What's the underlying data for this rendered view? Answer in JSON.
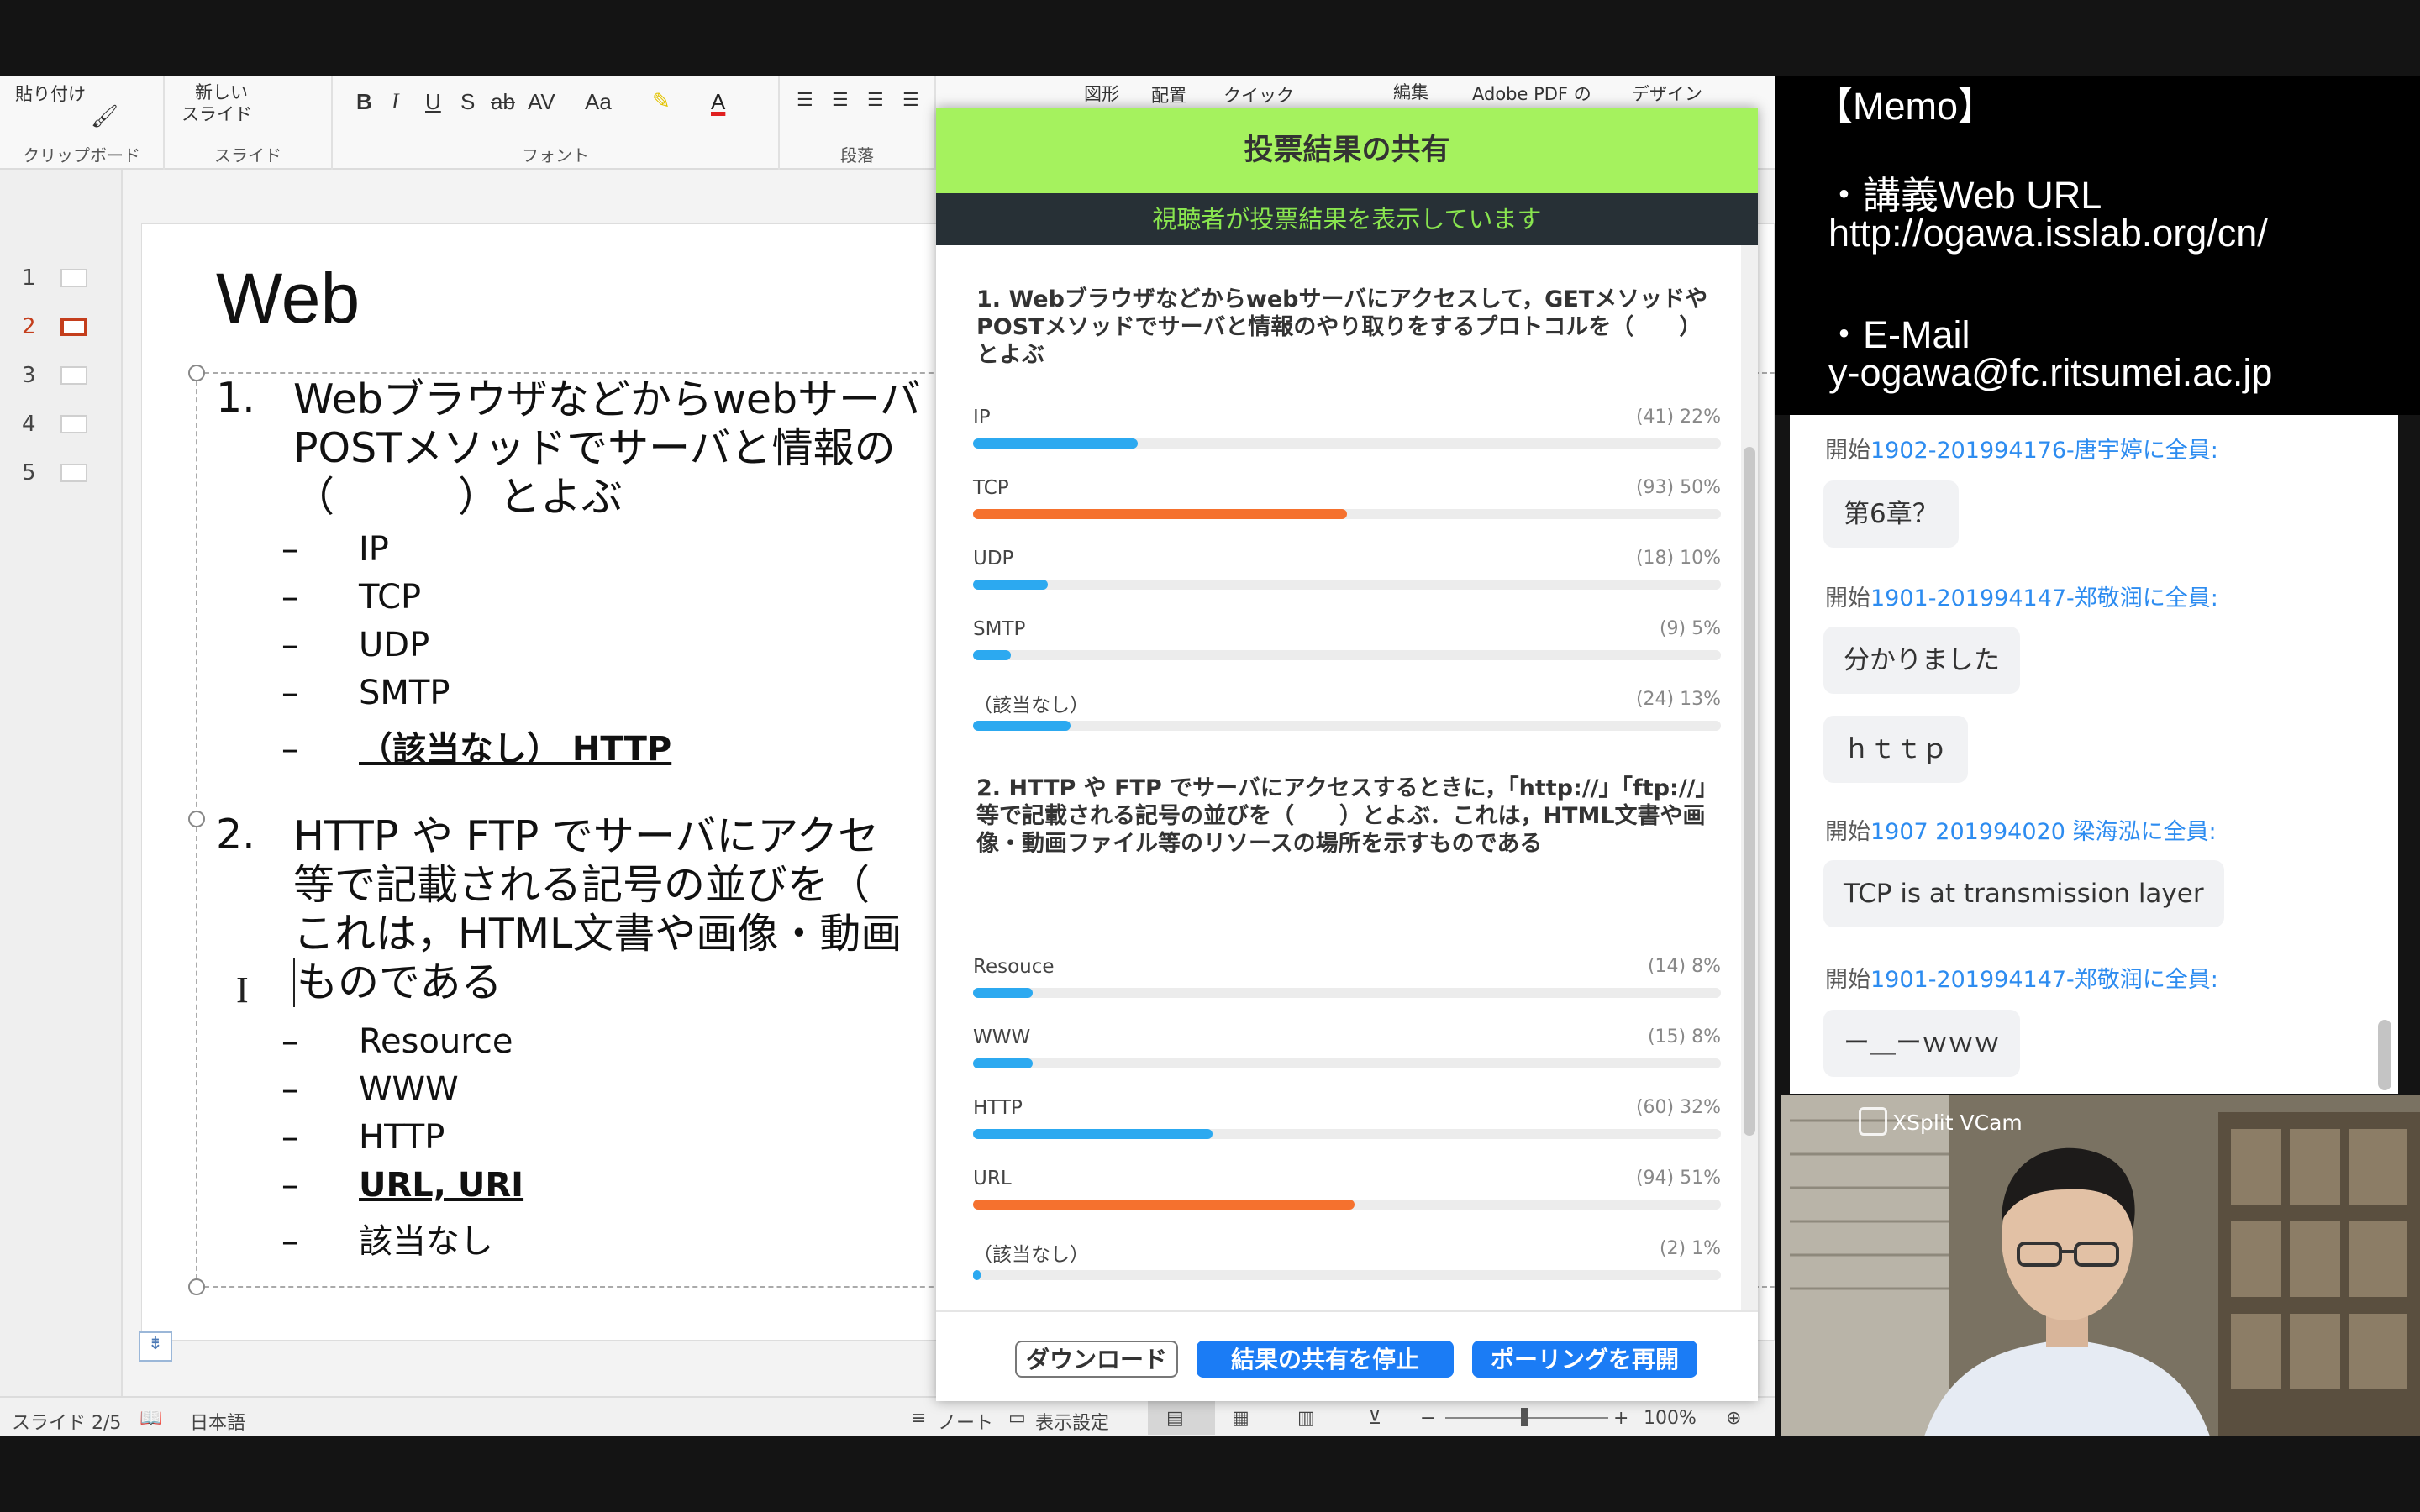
{
  "ribbon": {
    "paste": "貼り付け",
    "new_slide_1": "新しい",
    "new_slide_2": "スライド",
    "group_clipboard": "クリップボード",
    "group_slide": "スライド",
    "group_font": "フォント",
    "group_paragraph": "段落",
    "bold": "B",
    "italic": "I",
    "underline": "U",
    "shadow": "S",
    "strike": "ab",
    "spacing": "AV",
    "case": "Aa",
    "font_color": "A",
    "shapes": "図形",
    "arrange": "配置",
    "quick": "クイック",
    "edit": "編集",
    "adobe": "Adobe PDF の",
    "design": "デザイン"
  },
  "thumbnails": [
    "1",
    "2",
    "3",
    "4",
    "5"
  ],
  "slide": {
    "title": "Web",
    "q1_num": "1.",
    "q1_lines": [
      "Webブラウザなどからwebサーバ",
      "POSTメソッドでサーバと情報の",
      "（　　　）とよぶ"
    ],
    "q1_options": [
      "IP",
      "TCP",
      "UDP",
      "SMTP",
      "（該当なし） HTTP"
    ],
    "q2_num": "2.",
    "q2_lines": [
      "HTTP や FTP でサーバにアクセ",
      "等で記載される記号の並びを（",
      "これは，HTML文書や画像・動画",
      "ものである"
    ],
    "q2_options": [
      "Resource",
      "WWW",
      "HTTP",
      "URL, URI",
      "該当なし"
    ]
  },
  "status": {
    "slide": "スライド 2/5",
    "lang": "日本語",
    "notes": "ノート",
    "display": "表示設定",
    "zoom": "100%"
  },
  "poll": {
    "title": "投票結果の共有",
    "subtitle": "視聴者が投票結果を表示しています",
    "q1": "1. Webブラウザなどからwebサーバにアクセスして，GETメソッドやPOSTメソッドでサーバと情報のやり取りをするプロトコルを（　　）とよぶ",
    "q1_results": [
      {
        "label": "IP",
        "count": "(41)",
        "pct": "22%",
        "value": 22,
        "color": "#2ca9f0"
      },
      {
        "label": "TCP",
        "count": "(93)",
        "pct": "50%",
        "value": 50,
        "color": "#f5712e"
      },
      {
        "label": "UDP",
        "count": "(18)",
        "pct": "10%",
        "value": 10,
        "color": "#2ca9f0"
      },
      {
        "label": "SMTP",
        "count": "(9)",
        "pct": "5%",
        "value": 5,
        "color": "#2ca9f0"
      },
      {
        "label": "（該当なし）",
        "count": "(24)",
        "pct": "13%",
        "value": 13,
        "color": "#2ca9f0"
      }
    ],
    "q2": "2. HTTP や FTP でサーバにアクセスするときに，「http://」「ftp://」等で記載される記号の並びを（　　）とよぶ．これは，HTML文書や画像・動画ファイル等のリソースの場所を示すものである",
    "q2_results": [
      {
        "label": "Resouce",
        "count": "(14)",
        "pct": "8%",
        "value": 8,
        "color": "#2ca9f0"
      },
      {
        "label": "WWW",
        "count": "(15)",
        "pct": "8%",
        "value": 8,
        "color": "#2ca9f0"
      },
      {
        "label": "HTTP",
        "count": "(60)",
        "pct": "32%",
        "value": 32,
        "color": "#2ca9f0"
      },
      {
        "label": "URL",
        "count": "(94)",
        "pct": "51%",
        "value": 51,
        "color": "#f5712e"
      },
      {
        "label": "（該当なし）",
        "count": "(2)",
        "pct": "1%",
        "value": 1,
        "color": "#2ca9f0"
      }
    ],
    "download": "ダウンロード",
    "stop_share": "結果の共有を停止",
    "restart": "ポーリングを再開"
  },
  "memo": {
    "heading": "【Memo】",
    "lecture_label": "・講義Web URL",
    "lecture_url": "http://ogawa.isslab.org/cn/",
    "email_label": "・E-Mail",
    "email": "y-ogawa@fc.ritsumei.ac.jp"
  },
  "chat": [
    {
      "prefix": "開始",
      "who": "1902-201994176-唐宇婷",
      "suffix": "に全員:",
      "msg": "第6章？"
    },
    {
      "prefix": "開始",
      "who": "1901-201994147-郑敬润",
      "suffix": "に全員:",
      "msg": "分かりました"
    },
    {
      "msg": "ｈｔｔｐ"
    },
    {
      "prefix": "開始",
      "who": "1907 201994020 梁海泓",
      "suffix": "に全員:",
      "msg": "TCP is at transmission layer"
    },
    {
      "prefix": "開始",
      "who": "1901-201994147-郑敬润",
      "suffix": "に全員:",
      "msg": "ー＿ーｗｗｗ"
    }
  ],
  "webcam": {
    "label": "XSplit VCam"
  }
}
